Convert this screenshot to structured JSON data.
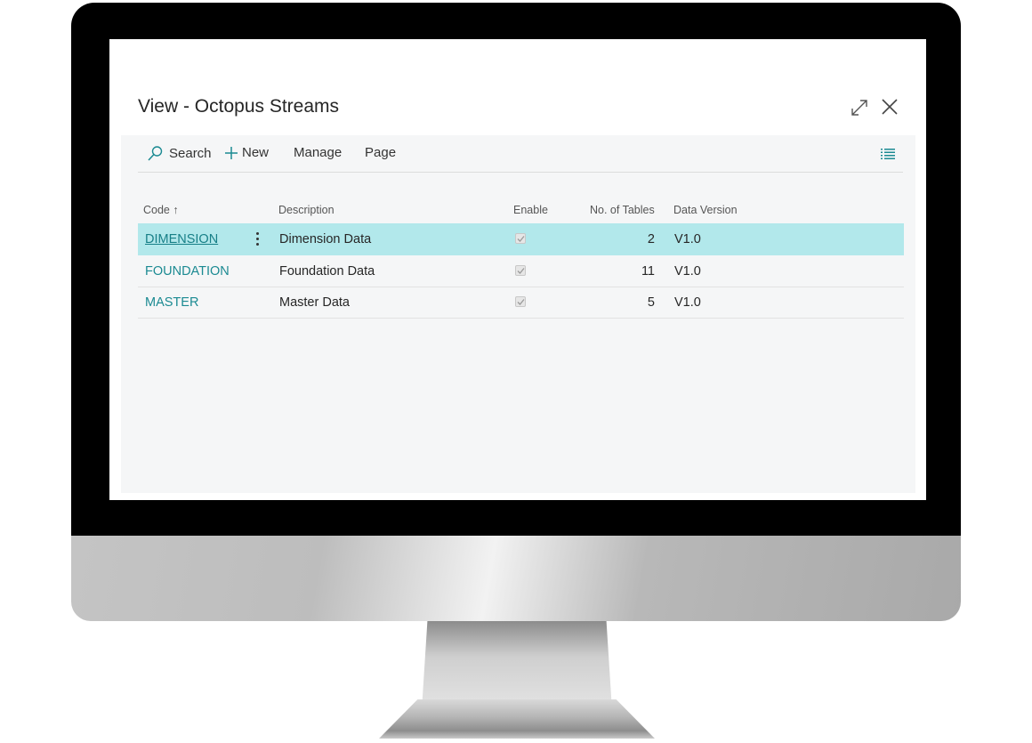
{
  "window": {
    "title": "View - Octopus Streams",
    "icons": [
      "expand-icon",
      "close-icon"
    ]
  },
  "toolbar": {
    "search_label": "Search",
    "new_label": "New",
    "manage_label": "Manage",
    "page_label": "Page"
  },
  "table": {
    "columns": {
      "code": "Code ↑",
      "description": "Description",
      "enable": "Enable",
      "tables": "No. of Tables",
      "version": "Data Version"
    },
    "rows": [
      {
        "code": "DIMENSION",
        "description": "Dimension Data",
        "enable": true,
        "tables": "2",
        "version": "V1.0",
        "selected": true
      },
      {
        "code": "FOUNDATION",
        "description": "Foundation Data",
        "enable": true,
        "tables": "11",
        "version": "V1.0",
        "selected": false
      },
      {
        "code": "MASTER",
        "description": "Master Data",
        "enable": true,
        "tables": "5",
        "version": "V1.0",
        "selected": false
      }
    ]
  },
  "colors": {
    "accent": "#1b8a92",
    "selected_row": "#b2e8eb",
    "panel_bg": "#f5f6f7"
  }
}
